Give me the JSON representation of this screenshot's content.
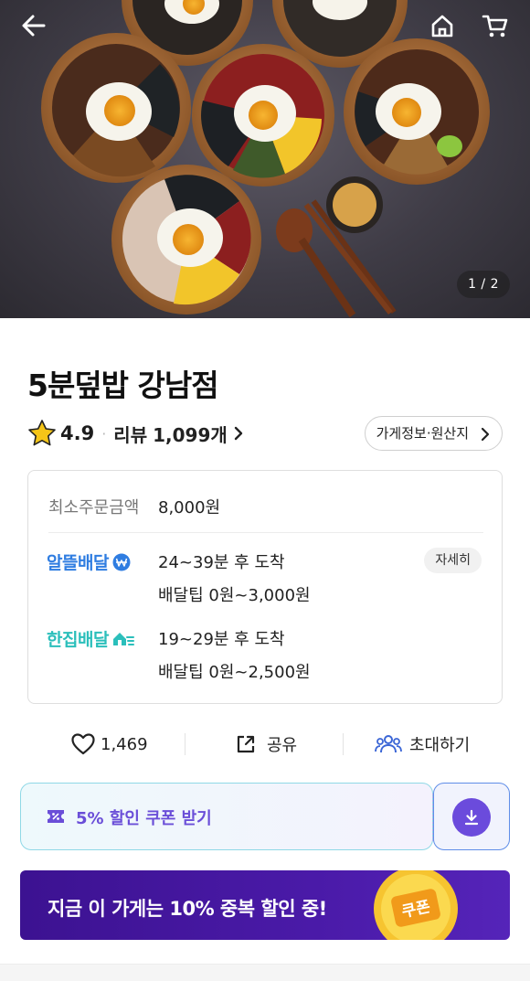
{
  "hero": {
    "pager": "1 / 2"
  },
  "store": {
    "name": "5분덮밥 강남점",
    "rating": "4.9",
    "separator": "·",
    "review_label": "리뷰",
    "review_count": "1,099개",
    "info_button": "가게정보·원산지"
  },
  "delivery": {
    "min_order_label": "최소주문금액",
    "min_order_value": "8,000원",
    "options": [
      {
        "brand": "알뜰배달",
        "eta": "24~39분 후 도착",
        "tip": "배달팁 0원~3,000원"
      },
      {
        "brand": "한집배달",
        "eta": "19~29분 후 도착",
        "tip": "배달팁 0원~2,500원"
      }
    ],
    "detail_button": "자세히"
  },
  "actions": {
    "likes": "1,469",
    "share": "공유",
    "invite": "초대하기"
  },
  "coupon": {
    "label": "5% 할인 쿠폰 받기"
  },
  "banner": {
    "text": "지금 이 가게는 10% 중복 할인 중!",
    "coin_text": "쿠폰"
  },
  "colors": {
    "brand_purple": "#6b4bdc",
    "alddeul_blue": "#2f7de1",
    "hanjip_teal": "#2bbfbb",
    "banner_bg": "#3c1291",
    "star": "#f5c518"
  }
}
